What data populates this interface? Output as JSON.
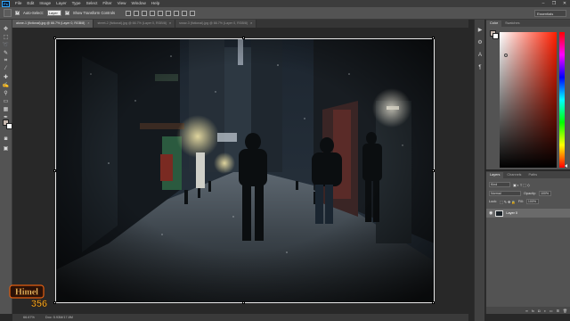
{
  "menubar": {
    "logo": "Ps",
    "items": [
      "File",
      "Edit",
      "Image",
      "Layer",
      "Type",
      "Select",
      "Filter",
      "View",
      "Window",
      "Help"
    ],
    "window_controls": [
      "–",
      "❐",
      "✕"
    ]
  },
  "options_bar": {
    "auto_select_label": "Auto-Select:",
    "auto_select_value": "Layer",
    "show_transform_label": "Show Transform Controls",
    "workspace": "Essentials"
  },
  "doc_tabs": [
    {
      "label": "alone-1 (fictional).jpg @ 66.7% (Layer 0, RGB/8)",
      "active": true
    },
    {
      "label": "street-2 (fictional).jpg @ 66.7% (Layer 0, RGB/8)",
      "active": false
    },
    {
      "label": "snow-3 (fictional).jpg @ 66.7% (Layer 0, RGB/8)",
      "active": false
    }
  ],
  "status_bar": {
    "zoom": "66.67%",
    "doc_info": "Doc: 5.93M/17.8M"
  },
  "color_panel": {
    "tabs": [
      "Color",
      "Swatches"
    ],
    "foreground": "#c8b9b0",
    "background": "#ffffff",
    "hue": "#ff1e00"
  },
  "layers_panel": {
    "tabs": [
      "Layers",
      "Channels",
      "Paths"
    ],
    "filter_label": "Kind",
    "blend_mode": "Normal",
    "opacity_label": "Opacity:",
    "opacity_value": "100%",
    "lock_label": "Lock:",
    "fill_label": "Fill:",
    "fill_value": "100%",
    "layer_name": "Layer 0",
    "footer_icons": [
      "link-icon",
      "fx-icon",
      "mask-icon",
      "adjustment-icon",
      "folder-icon",
      "new-layer-icon",
      "trash-icon"
    ]
  },
  "watermark": {
    "line1": "Himel",
    "line2": "356"
  },
  "canvas": {
    "content": "Night alley photo with falling snow, figures in hooded jackets, street lamps and bollards"
  }
}
